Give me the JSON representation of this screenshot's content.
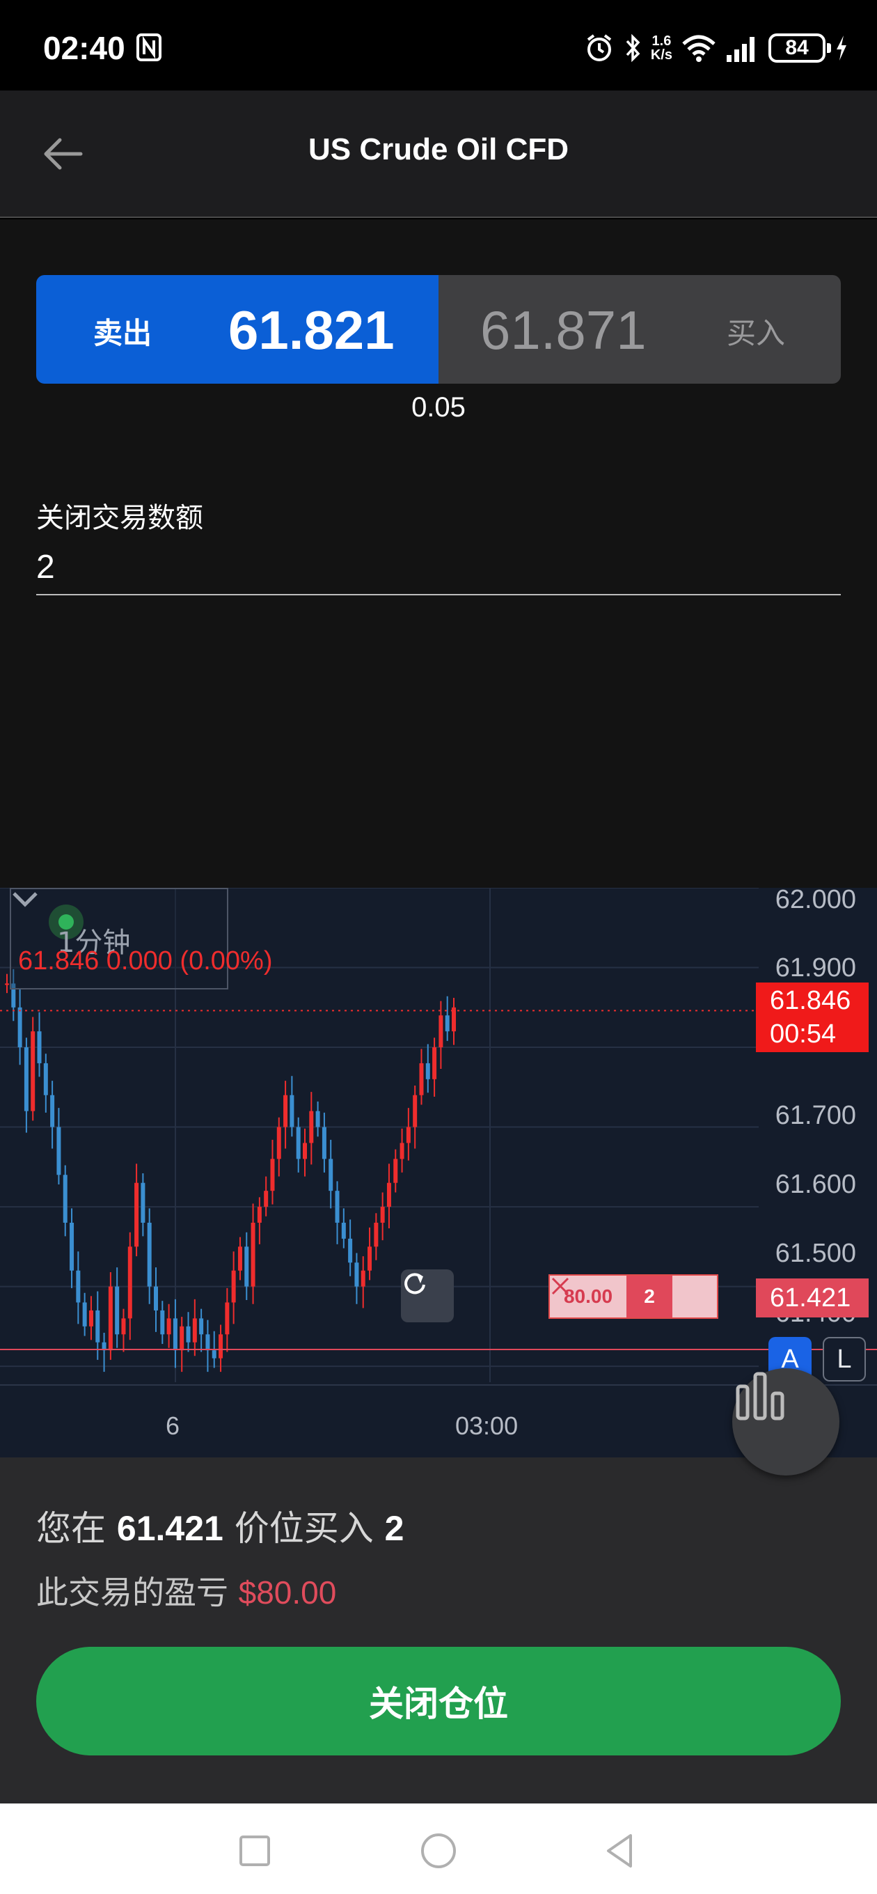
{
  "status_bar": {
    "time": "02:40",
    "net_speed_value": "1.6",
    "net_speed_unit": "K/s",
    "battery": "84"
  },
  "header": {
    "title": "US Crude Oil CFD"
  },
  "trade": {
    "sell_label": "卖出",
    "sell_price": "61.821",
    "buy_price": "61.871",
    "buy_label": "买入",
    "spread": "0.05"
  },
  "quantity": {
    "label": "关闭交易数额",
    "value": "2"
  },
  "chart": {
    "timeframe": "1分钟",
    "ohlc_line": "61.846  0.000 (0.00%)",
    "current_price": "61.846",
    "countdown": "00:54",
    "position_price": "61.421",
    "position_pnl": "80.00",
    "position_qty": "2",
    "btn_auto": "A",
    "btn_log": "L",
    "x_labels": [
      "6",
      "03:00"
    ],
    "y_labels": [
      "62.000",
      "61.900",
      "61.700",
      "61.600",
      "61.500",
      "61.400"
    ]
  },
  "chart_data": {
    "type": "candlestick",
    "timeframe": "1分钟",
    "ylim": [
      61.38,
      62.0
    ],
    "y_ticks": [
      62.0,
      61.9,
      61.8,
      61.7,
      61.6,
      61.5,
      61.4
    ],
    "x_labels": [
      "6",
      "03:00"
    ],
    "last_price": 61.846,
    "position_line": 61.421,
    "close_series": [
      61.88,
      61.85,
      61.8,
      61.72,
      61.82,
      61.78,
      61.74,
      61.7,
      61.64,
      61.58,
      61.52,
      61.48,
      61.45,
      61.47,
      61.43,
      61.42,
      61.5,
      61.44,
      61.46,
      61.55,
      61.63,
      61.58,
      61.5,
      61.47,
      61.44,
      61.46,
      61.42,
      61.45,
      61.43,
      61.46,
      61.44,
      61.42,
      61.41,
      61.44,
      61.48,
      61.52,
      61.55,
      61.5,
      61.58,
      61.6,
      61.62,
      61.66,
      61.7,
      61.74,
      61.7,
      61.66,
      61.68,
      61.72,
      61.7,
      61.66,
      61.62,
      61.58,
      61.56,
      61.53,
      61.5,
      61.52,
      61.55,
      61.58,
      61.6,
      61.63,
      61.66,
      61.68,
      61.7,
      61.74,
      61.78,
      61.76,
      61.8,
      61.84,
      61.82,
      61.85
    ]
  },
  "position": {
    "desc_prefix": "您在",
    "desc_price": "61.421",
    "desc_mid": "价位买入",
    "desc_qty": "2",
    "pnl_label": "此交易的盈亏",
    "pnl_value": "$80.00",
    "close_button": "关闭仓位"
  },
  "colors": {
    "sell": "#0b5fd6",
    "buy": "#3f3f41",
    "close_button": "#22a04f",
    "price_tag": "#f01a1a",
    "pnl": "#e04c5c"
  }
}
